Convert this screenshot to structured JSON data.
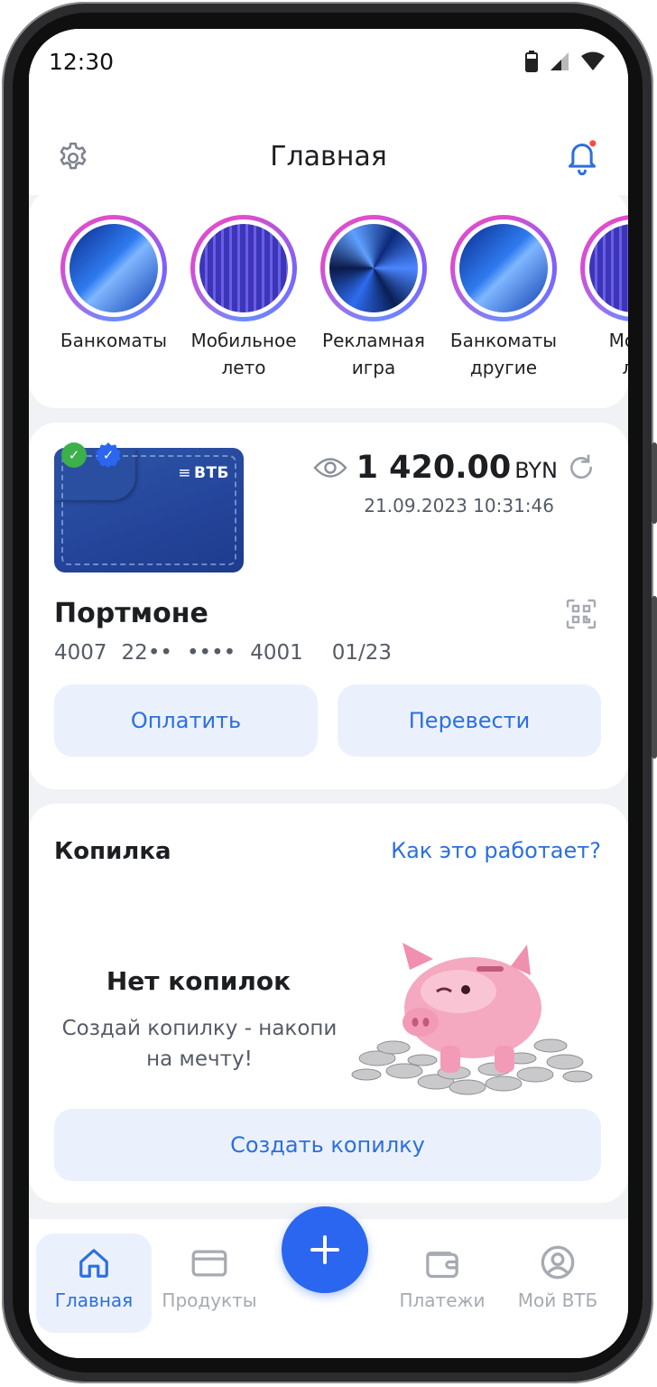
{
  "status": {
    "time": "12:30"
  },
  "header": {
    "title": "Главная",
    "settings_icon": "gear-icon",
    "notifications_icon": "bell-icon",
    "accent": "#2c6fe0"
  },
  "stories": [
    {
      "label": "Банкоматы"
    },
    {
      "label": "Мобильное\nлето"
    },
    {
      "label": "Рекламная\nигра"
    },
    {
      "label": "Банкоматы\nдругие"
    },
    {
      "label": "Моби\nле"
    }
  ],
  "account": {
    "bank_logo": "ВТБ",
    "amount": "1 420.00",
    "currency": "BYN",
    "updated": "21.09.2023 10:31:46",
    "name": "Портмоне",
    "card_number": [
      "4007",
      "22••",
      "••••",
      "4001"
    ],
    "expiry": "01/23",
    "pay_label": "Оплатить",
    "transfer_label": "Перевести"
  },
  "piggy": {
    "title": "Копилка",
    "how_link": "Как это работает?",
    "empty_title": "Нет копилок",
    "empty_subtitle": "Создай копилку - накопи на мечту!",
    "create_label": "Создать копилку"
  },
  "tabbar": {
    "home": "Главная",
    "products": "Продукты",
    "payments": "Платежи",
    "profile": "Мой ВТБ"
  }
}
